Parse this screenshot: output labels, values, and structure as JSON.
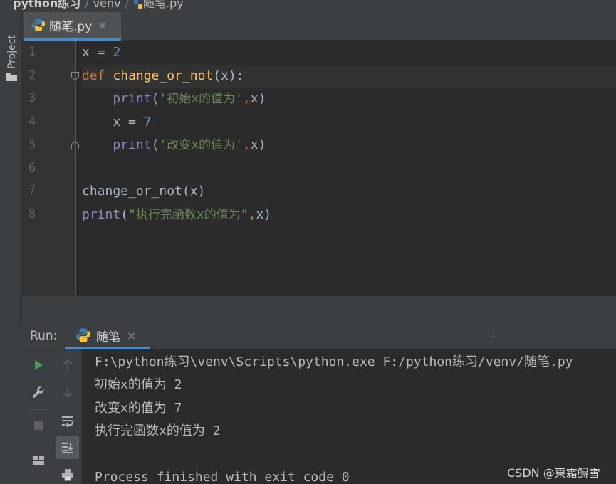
{
  "breadcrumb": {
    "project": "python练习",
    "folder": "venv",
    "file": "随笔.py"
  },
  "left_strip": {
    "project_label": "Project"
  },
  "editor_tab": {
    "label": "随笔.py",
    "close": "×"
  },
  "editor": {
    "line_numbers": [
      "1",
      "2",
      "3",
      "4",
      "5",
      "6",
      "7",
      "8"
    ],
    "lines": [
      [
        {
          "t": "x = ",
          "c": "plain"
        },
        {
          "t": "2",
          "c": "num"
        }
      ],
      [
        {
          "t": "def ",
          "c": "kw"
        },
        {
          "t": "change_or_not",
          "c": "fn"
        },
        {
          "t": "(x):",
          "c": "plain"
        }
      ],
      [
        {
          "t": "    ",
          "c": "plain"
        },
        {
          "t": "print",
          "c": "builtin"
        },
        {
          "t": "(",
          "c": "plain"
        },
        {
          "t": "'",
          "c": "str"
        },
        {
          "t": "初始",
          "c": "str cjk"
        },
        {
          "t": "x",
          "c": "str"
        },
        {
          "t": "的值为",
          "c": "str cjk"
        },
        {
          "t": "'",
          "c": "str"
        },
        {
          "t": ",",
          "c": "kw"
        },
        {
          "t": "x)",
          "c": "plain"
        }
      ],
      [
        {
          "t": "    x = ",
          "c": "plain"
        },
        {
          "t": "7",
          "c": "num"
        }
      ],
      [
        {
          "t": "    ",
          "c": "plain"
        },
        {
          "t": "print",
          "c": "builtin"
        },
        {
          "t": "(",
          "c": "plain"
        },
        {
          "t": "'",
          "c": "str"
        },
        {
          "t": "改变",
          "c": "str cjk"
        },
        {
          "t": "x",
          "c": "str"
        },
        {
          "t": "的值为",
          "c": "str cjk"
        },
        {
          "t": "'",
          "c": "str"
        },
        {
          "t": ",",
          "c": "kw"
        },
        {
          "t": "x)",
          "c": "plain"
        }
      ],
      [],
      [
        {
          "t": "change_or_not(x)",
          "c": "plain"
        }
      ],
      [
        {
          "t": "print",
          "c": "builtin"
        },
        {
          "t": "(",
          "c": "plain"
        },
        {
          "t": "\"",
          "c": "str"
        },
        {
          "t": "执行完函数",
          "c": "str cjk"
        },
        {
          "t": "x",
          "c": "str"
        },
        {
          "t": "的值为",
          "c": "str cjk"
        },
        {
          "t": "\"",
          "c": "str"
        },
        {
          "t": ",",
          "c": "kw"
        },
        {
          "t": "x)",
          "c": "plain"
        }
      ]
    ]
  },
  "run": {
    "title": "Run:",
    "tab_label": "随笔",
    "tab_close": "×",
    "options": ":",
    "toolbar": [
      "run-icon",
      "wrench-icon",
      "stop-icon",
      "layout-icon",
      "up-arrow-icon",
      "down-arrow-icon",
      "soft-wrap-icon",
      "scroll-to-end-icon",
      "print-icon"
    ],
    "console_lines": [
      "F:\\python练习\\venv\\Scripts\\python.exe F:/python练习/venv/随笔.py",
      "初始x的值为 2",
      "改变x的值为 7",
      "执行完函数x的值为 2",
      "",
      "Process finished with exit code 0"
    ]
  },
  "watermark": "CSDN @東霜鲟雪",
  "colors": {
    "keyword": "#cc7832",
    "function": "#ffc66d",
    "number": "#6897bb",
    "string": "#6a8759",
    "builtin": "#8888c6",
    "accent": "#4a88c7",
    "run_green": "#499c54"
  }
}
